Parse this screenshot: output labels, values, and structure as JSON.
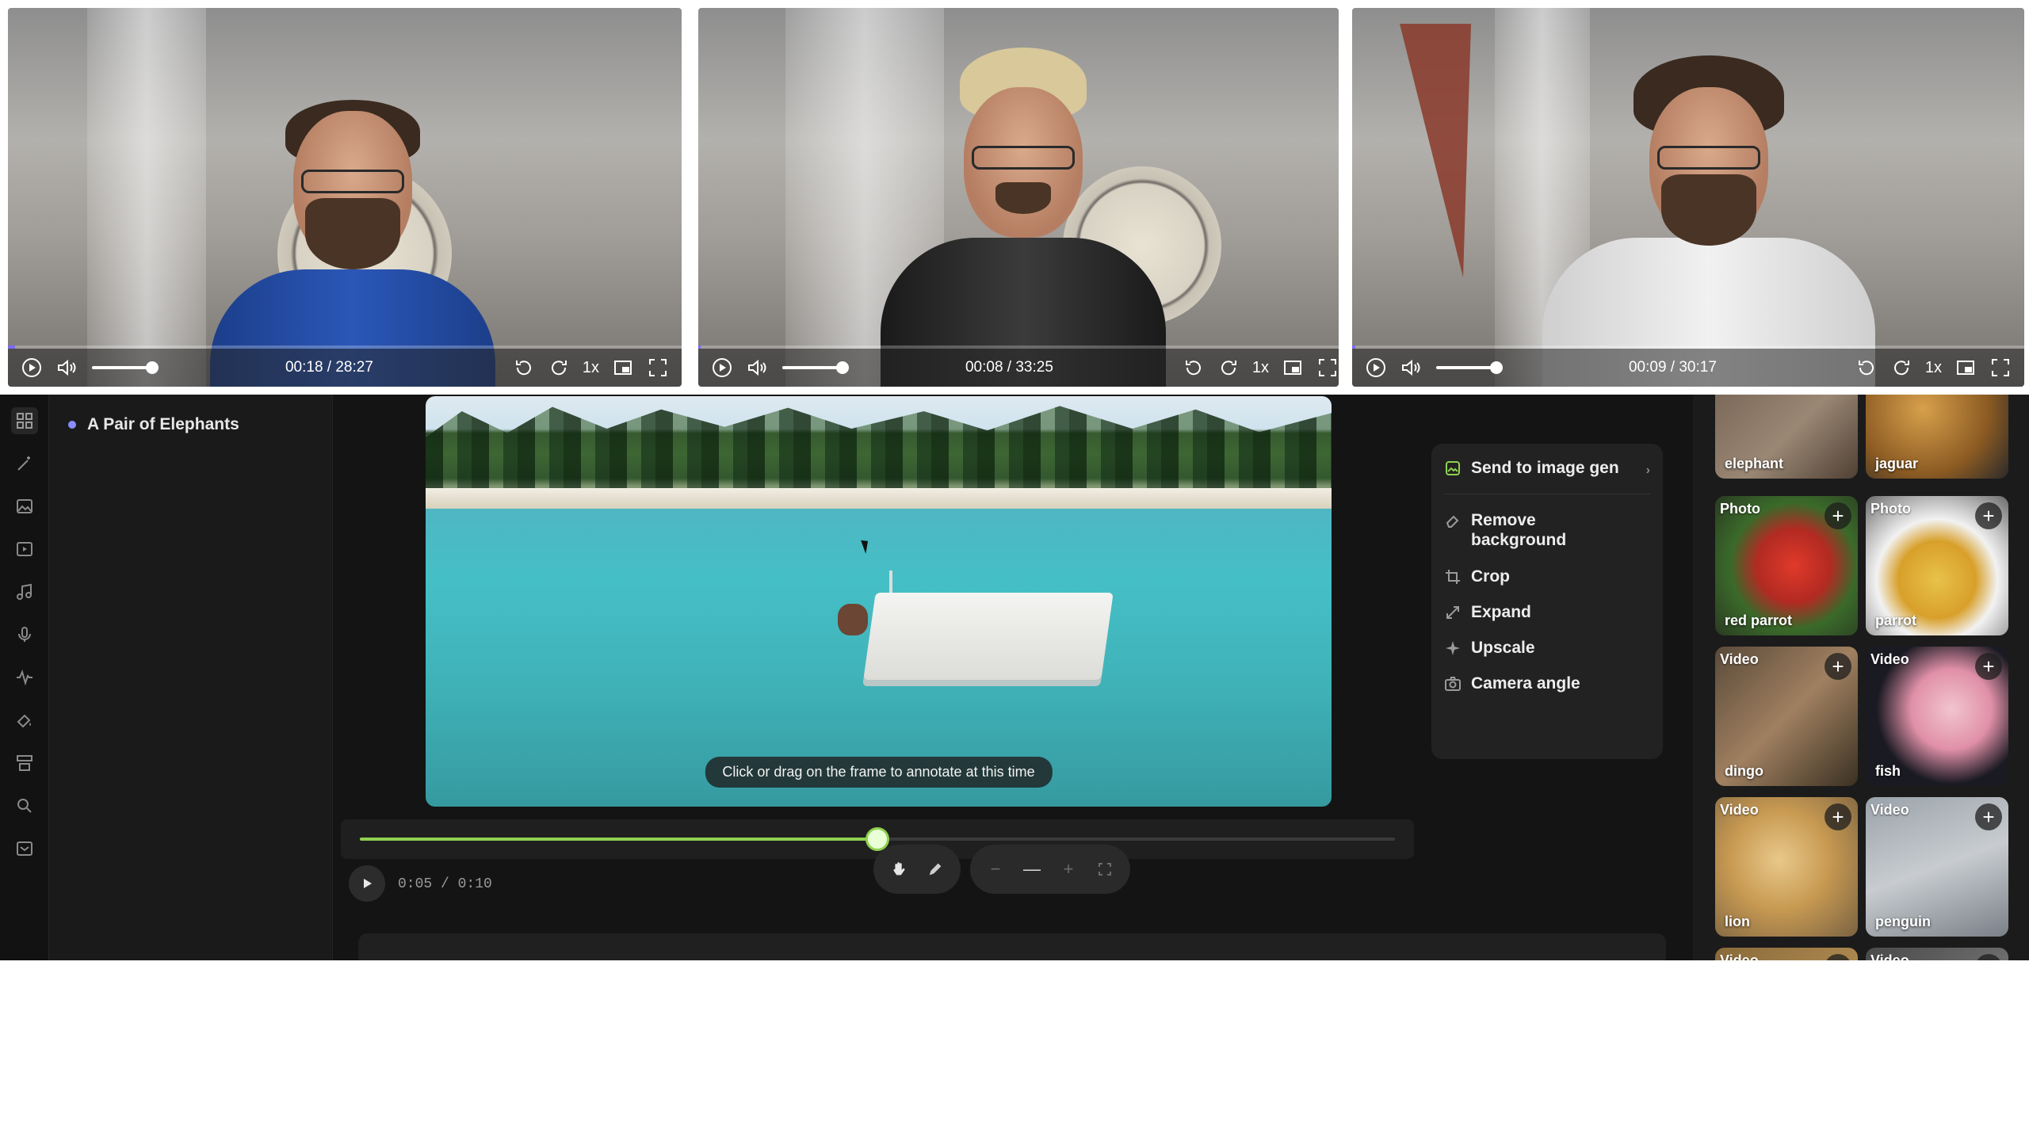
{
  "players": [
    {
      "time": "00:18 / 28:27",
      "speed": "1x",
      "progress": 0.011
    },
    {
      "time": "00:08 / 33:25",
      "speed": "1x",
      "progress": 0.004
    },
    {
      "time": "00:09 / 30:17",
      "speed": "1x",
      "progress": 0.005
    }
  ],
  "editor": {
    "layers": [
      {
        "label": "A Pair of Elephants"
      }
    ],
    "canvas": {
      "hint": "Click or drag on the frame to annotate at this time"
    },
    "playback": {
      "time": "0:05 / 0:10",
      "progress": 0.5
    },
    "menu": {
      "send": "Send to image gen",
      "remove_bg": "Remove background",
      "crop": "Crop",
      "expand": "Expand",
      "upscale": "Upscale",
      "camera_angle": "Camera angle"
    },
    "gallery": [
      {
        "tag": "",
        "caption": "elephant"
      },
      {
        "tag": "",
        "caption": "jaguar"
      },
      {
        "tag": "Photo",
        "caption": "red parrot"
      },
      {
        "tag": "Photo",
        "caption": "parrot"
      },
      {
        "tag": "Video",
        "caption": "dingo"
      },
      {
        "tag": "Video",
        "caption": "fish"
      },
      {
        "tag": "Video",
        "caption": "lion"
      },
      {
        "tag": "Video",
        "caption": "penguin"
      },
      {
        "tag": "Video",
        "caption": ""
      },
      {
        "tag": "Video",
        "caption": ""
      }
    ]
  },
  "colors": {
    "accent_green": "#8fd14f",
    "player_progress": "#7c6cf0",
    "layer_dot": "#8a8cff"
  }
}
